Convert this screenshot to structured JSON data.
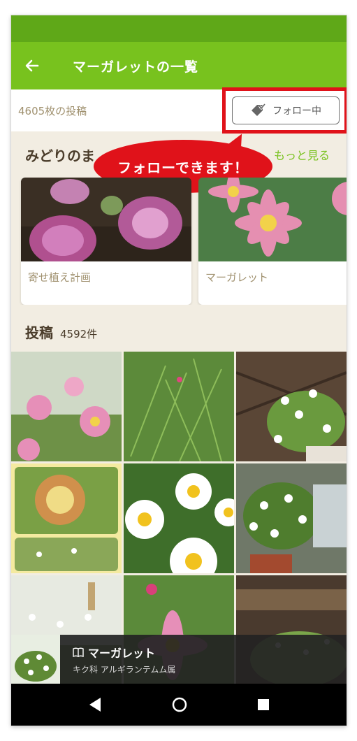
{
  "app_bar": {
    "title": "マーガレットの一覧"
  },
  "post_count_bar": {
    "count_text": "4605枚の投稿",
    "follow_button_label": "フォロー中"
  },
  "callout": {
    "text": "フォローできます！"
  },
  "collections": {
    "title": "みどりのま",
    "more_label": "もっと見る",
    "cards": [
      {
        "label": "寄せ植え計画"
      },
      {
        "label": "マーガレット"
      }
    ]
  },
  "posts": {
    "title": "投稿",
    "count": "4592件"
  },
  "bottom_info": {
    "name": "マーガレット",
    "classification": "キク科 アルギランテムム属"
  },
  "colors": {
    "app_bar": "#78c21e",
    "status_bar": "#5fa818",
    "accent_red": "#e0121a",
    "background": "#f2ede2"
  }
}
